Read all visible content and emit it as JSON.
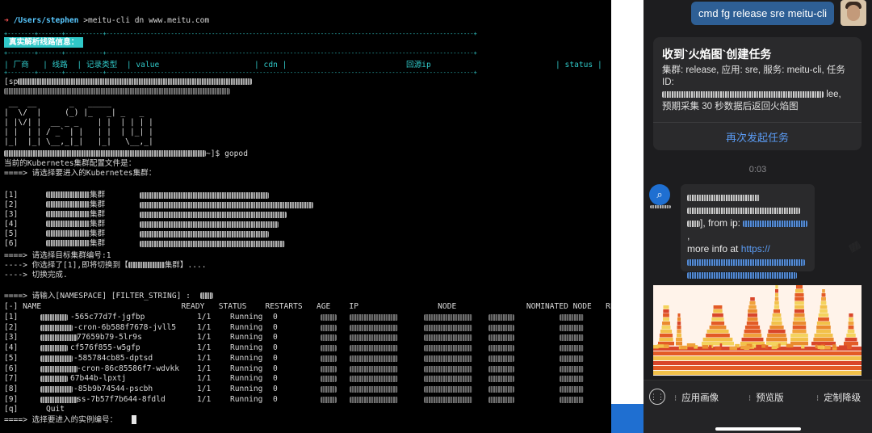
{
  "terminal": {
    "prompt_arrow": "➜",
    "prompt_path": "/Users/stephen",
    "prompt_cmd": ">meitu-cli dn www.meitu.com",
    "banner": "真实解析线路信息：",
    "sep_line": "+--------+-------+-----------+------------------------------------------------------------------------------------------------------------+",
    "header": "| 厂商   | 线路  | 记录类型  | value                                       | cdn |                              回源ip                               | status |",
    "login_prefix": "[sp",
    "ascii_art": [
      " __  __       _   _____",
      "|  \\/  |     (_) |_   _| _   _",
      "| |\\/| |  __ _ _    | |  | | | |",
      "| |  | | / _` | |   | |  | |_| |",
      "|_|  |_| \\__,_|_|   |_|   \\__,_|"
    ],
    "gopod_suffix": "~]$ gopod",
    "kube_config": "当前的Kubernetes集群配置文件是：",
    "choose_cluster": "====> 请选择要进入的Kubernetes集群：",
    "clusters": [
      {
        "idx": "[1]",
        "suffix": "集群"
      },
      {
        "idx": "[2]",
        "suffix": "集群"
      },
      {
        "idx": "[3]",
        "suffix": "集群"
      },
      {
        "idx": "[4]",
        "suffix": "集群"
      },
      {
        "idx": "[5]",
        "suffix": "集群"
      },
      {
        "idx": "[6]",
        "suffix": "集群"
      }
    ],
    "choose_number": "====> 请选择目标集群编号:1",
    "switched": "----> 你选择了[1],即将切换到【",
    "switched_tail": "集群】....",
    "switch_done": "----> 切换完成.",
    "namespace_prompt": "====> 请输入[NAMESPACE] [FILTER_STRING] :",
    "pod_header": "[-] NAME                              READY   STATUS    RESTARTS   AGE    IP                 NODE               NOMINATED NODE   READINESS GATES",
    "pods": [
      {
        "idx": "[1]",
        "name": "-565c77d7f-jgfbp",
        "ready": "1/1",
        "status": "Running",
        "restarts": "0"
      },
      {
        "idx": "[2]",
        "name": "-cron-6b588f7678-jvll5",
        "ready": "1/1",
        "status": "Running",
        "restarts": "0"
      },
      {
        "idx": "[3]",
        "name": "77659b79-5lr9s",
        "ready": "1/1",
        "status": "Running",
        "restarts": "0"
      },
      {
        "idx": "[4]",
        "name": "cf576f855-w5gfp",
        "ready": "1/1",
        "status": "Running",
        "restarts": "0"
      },
      {
        "idx": "[5]",
        "name": "-585784cb85-dptsd",
        "ready": "1/1",
        "status": "Running",
        "restarts": "0"
      },
      {
        "idx": "[6]",
        "name": "-cron-86c85586f7-wdvkk",
        "ready": "1/1",
        "status": "Running",
        "restarts": "0"
      },
      {
        "idx": "[7]",
        "name": "67b44b-lpxtj",
        "ready": "1/1",
        "status": "Running",
        "restarts": "0"
      },
      {
        "idx": "[8]",
        "name": "-85b9b74544-pscbh",
        "ready": "1/1",
        "status": "Running",
        "restarts": "0"
      },
      {
        "idx": "[9]",
        "name": "ss-7b57f7b644-8fdld",
        "ready": "1/1",
        "status": "Running",
        "restarts": "0"
      }
    ],
    "quit_idx": "[q]",
    "quit_label": "Quit",
    "select_instance": "====> 选择要进入的实例编号："
  },
  "chat": {
    "my_message": "cmd fg release sre meitu-cli",
    "card_title": "收到`火焰图`创建任务",
    "card_line1": "集群: release, 应用: sre, 服务: meitu-cli, 任务ID:",
    "card_line2_tail": "lee,",
    "card_line3": "预期采集 30 秒数据后返回火焰图",
    "card_button": "再次发起任务",
    "timestamp": "0:03",
    "bot_icon": "magnifier-icon",
    "bot_from": "], from ip:",
    "bot_more": "more info at",
    "bot_link": "https://",
    "toolbar": {
      "item1": "应用画像",
      "item2": "预览版",
      "item3": "定制降级"
    }
  },
  "colors": {
    "terminal_bg": "#000000",
    "accent_cyan": "#30c9c9",
    "chat_bg": "#1d1d1f",
    "my_bubble": "#2e5f95",
    "link": "#5b9cf5",
    "strip_blue": "#1f6fd1"
  }
}
